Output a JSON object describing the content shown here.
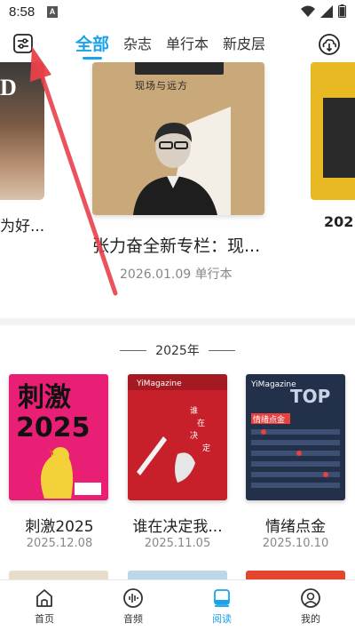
{
  "status": {
    "time": "8:58",
    "notif_letter": "A"
  },
  "tabs": [
    "全部",
    "杂志",
    "单行本",
    "新皮层"
  ],
  "carousel": {
    "left_title": "为好...",
    "left_cover_letter": "D",
    "main_cover_subtitle": "现场与远方",
    "main_title": "张力奋全新专栏：现...",
    "main_meta": "2026.01.09 单行本",
    "right_title": "202"
  },
  "section": {
    "year": "2025年"
  },
  "magazines": [
    {
      "title": "刺激2025",
      "date": "2025.12.08",
      "cover_text": "刺激2025",
      "color": "#e91f75"
    },
    {
      "title": "谁在决定我...",
      "date": "2025.11.05",
      "cover_text": "谁在决定",
      "color": "#c8202a"
    },
    {
      "title": "情绪点金",
      "date": "2025.10.10",
      "cover_text": "情绪点金",
      "color": "#22304a"
    }
  ],
  "nav": [
    {
      "label": "首页",
      "icon": "home-icon"
    },
    {
      "label": "音频",
      "icon": "audio-icon"
    },
    {
      "label": "阅读",
      "icon": "read-icon"
    },
    {
      "label": "我的",
      "icon": "profile-icon"
    }
  ],
  "colors": {
    "accent": "#1aa3e8",
    "arrow": "#e8414a"
  }
}
